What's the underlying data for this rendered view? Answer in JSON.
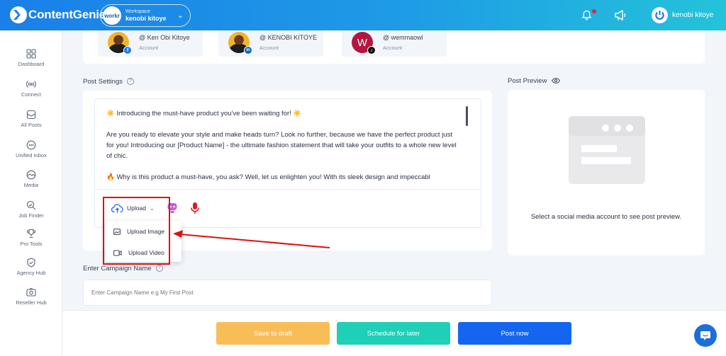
{
  "header": {
    "brand": "ContentGenie",
    "workspace": {
      "avatar_text": "workr",
      "label": "Workspace",
      "name": "kenobi kitoye"
    },
    "user_name": "kenobi kitoye"
  },
  "sidebar": {
    "items": [
      {
        "label": "Dashboard",
        "icon": "grid-icon"
      },
      {
        "label": "Connect",
        "icon": "broadcast-icon"
      },
      {
        "label": "All Posts",
        "icon": "posts-icon"
      },
      {
        "label": "Unified Inbox",
        "icon": "chat-bubble-icon"
      },
      {
        "label": "Media",
        "icon": "media-icon"
      },
      {
        "label": "Job Finder",
        "icon": "search-job-icon"
      },
      {
        "label": "Pro Tools",
        "icon": "trophy-icon"
      },
      {
        "label": "Agency Hub",
        "icon": "shield-icon"
      },
      {
        "label": "Reseller Hub",
        "icon": "camera-icon"
      }
    ]
  },
  "accounts": [
    {
      "name": "@ Ken Obi Kitoye",
      "type": "Account",
      "network": "facebook",
      "badge": "f"
    },
    {
      "name": "@ KENOBI KITOYE",
      "type": "Account",
      "network": "linkedin",
      "badge": "in"
    },
    {
      "name": "@ wemmaowl",
      "type": "Account",
      "network": "tiktok",
      "avatar_letter": "W",
      "badge": "♪"
    }
  ],
  "post_settings": {
    "title": "Post Settings",
    "help": "?",
    "content": [
      "☀️ Introducing the must-have product you've been waiting for! ☀️",
      "Are you ready to elevate your style and make heads turn? Look no further, because we have the perfect product just for you! Introducing our [Product Name] - the ultimate fashion statement that will take your outfits to a whole new level of chic.",
      "🔥 Why is this product a must-have, you ask? Well, let us enlighten you! With its sleek design and impeccabl"
    ],
    "upload_label": "Upload",
    "upload_menu": [
      "Upload Image",
      "Upload Video"
    ]
  },
  "campaign": {
    "title": "Enter Campaign Name",
    "help": "?",
    "placeholder": "Enter Campaign Name e.g My First Post"
  },
  "preview": {
    "title": "Post Preview",
    "message": "Select a social media account to see post preview."
  },
  "footer": {
    "save_draft": "Save to draft",
    "schedule": "Schedule for later",
    "post_now": "Post now"
  },
  "colors": {
    "accent": "#1466f0",
    "draft": "#f9bd58",
    "schedule": "#1fcfb8",
    "annotation": "#e01010"
  }
}
